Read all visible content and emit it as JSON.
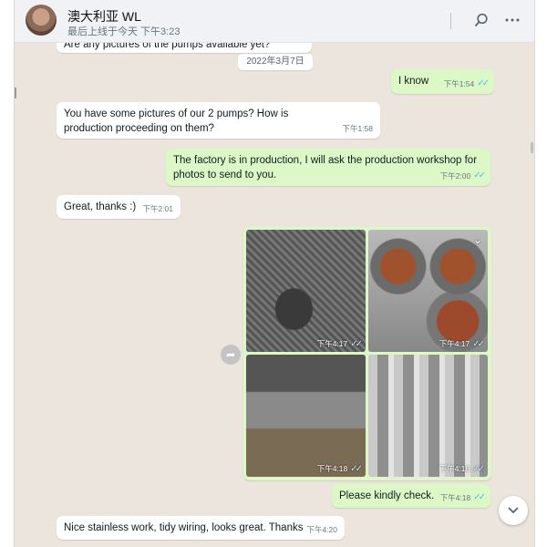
{
  "header": {
    "name": "澳大利亚 WL",
    "status": "最后上线于今天 下午3:23",
    "icons": [
      "search-icon",
      "more-icon"
    ]
  },
  "date_chip": "2022年3月7日",
  "messages": [
    {
      "dir": "in",
      "text": "Are any pictures of the pumps available yet?",
      "time": ""
    },
    {
      "dir": "out",
      "text": "I know",
      "time": "下午1:54",
      "ticks": true
    },
    {
      "dir": "in",
      "text": "You have some pictures of our 2 pumps? How is production proceeding on them?",
      "time": "下午1:58"
    },
    {
      "dir": "out",
      "text": "The factory is in production, I will ask the production workshop for photos to send to you.",
      "time": "下午2:00",
      "ticks": true
    },
    {
      "dir": "in",
      "text": "Great, thanks :)",
      "time": "下午2:01"
    },
    {
      "dir": "out",
      "text": "Please kindly check.",
      "time": "下午4:18",
      "ticks": true
    },
    {
      "dir": "in",
      "text": "Nice stainless work, tidy wiring, looks great. Thanks",
      "time": "下午4:20"
    }
  ],
  "photos": [
    {
      "time": "下午4:17",
      "subject": "pump parts on factory floor"
    },
    {
      "time": "下午4:17",
      "subject": "stator windings in housings"
    },
    {
      "time": "下午4:18",
      "subject": "workshop with pump bodies"
    },
    {
      "time": "下午4:18",
      "subject": "stainless steel cylinders"
    }
  ],
  "colors": {
    "chat_bg": "#ece5dd",
    "out_bubble": "#dcf8c6",
    "in_bubble": "#ffffff",
    "tick_blue": "#53bdeb"
  }
}
